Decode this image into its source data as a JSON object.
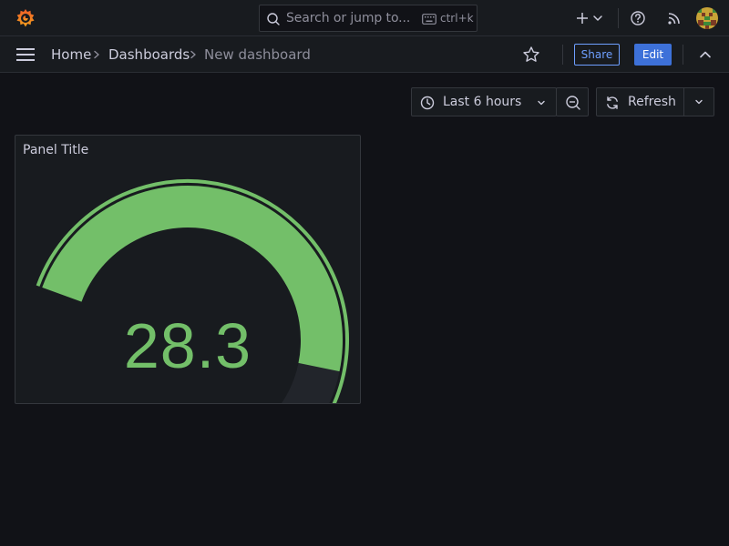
{
  "topbar": {
    "search": {
      "placeholder": "Search or jump to...",
      "shortcut": "ctrl+k"
    },
    "icons": [
      "grafana-logo-icon",
      "search-icon",
      "keyboard-icon",
      "plus-icon",
      "chevron-down-icon",
      "help-icon",
      "news-icon",
      "avatar"
    ]
  },
  "navbar": {
    "breadcrumb": [
      {
        "label": "Home"
      },
      {
        "label": "Dashboards"
      },
      {
        "label": "New dashboard"
      }
    ],
    "share_label": "Share",
    "edit_label": "Edit"
  },
  "toolbar": {
    "time_range_label": "Last 6 hours",
    "refresh_label": "Refresh"
  },
  "panel": {
    "title": "Panel Title",
    "gauge": {
      "value": "28.3",
      "numeric_value": 28.3,
      "fill_fraction": 0.78,
      "color": "#73bf69",
      "threshold_color": "#73bf69"
    }
  },
  "colors": {
    "background": "#111217",
    "surface": "#181b1f",
    "primary": "#3d71d9",
    "link": "#6e9fff",
    "green": "#73bf69"
  }
}
